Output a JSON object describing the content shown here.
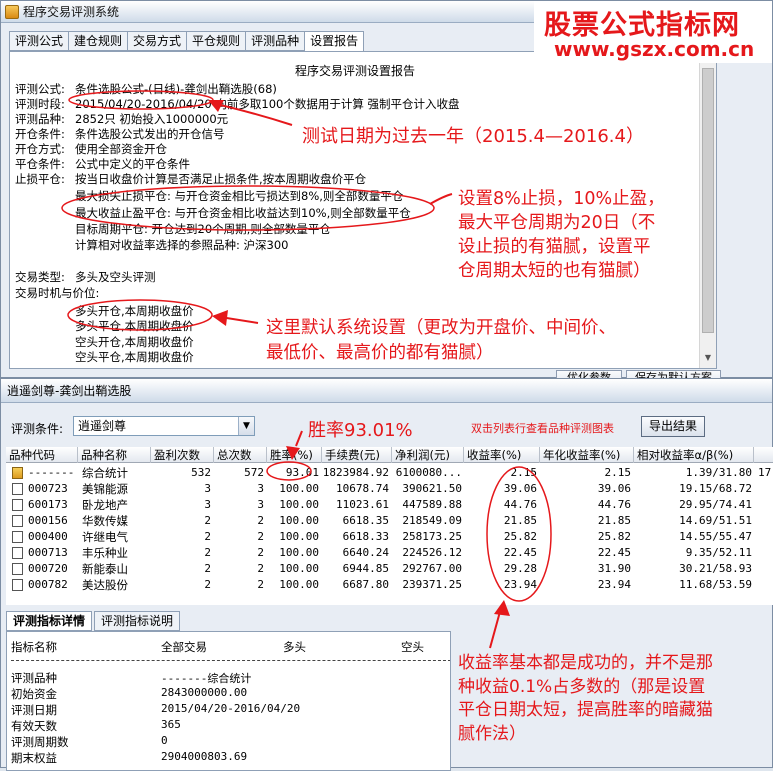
{
  "top_window": {
    "title": "程序交易评测系统",
    "tabs": [
      "评测公式",
      "建仓规则",
      "交易方式",
      "平仓规则",
      "评测品种",
      "设置报告"
    ],
    "active_tab_index": 5
  },
  "banner": {
    "line1": "股票公式指标网",
    "line2": "www.gszx.com.cn"
  },
  "report": {
    "title": "程序交易评测设置报告",
    "formula_label": "评测公式:",
    "formula_value": "条件选股公式-(日线)-龚剑出鞘选股(68)",
    "period_label": "评测时段:",
    "period_value": "2015/04/20-2016/04/20",
    "period_note": " 向前多取100个数据用于计算 强制平仓计入收盘",
    "stocks_label": "评测品种:",
    "stocks_value": "2852只 初始投入1000000元",
    "open_cond_label": "开仓条件:",
    "open_cond_value": "条件选股公式发出的开仓信号",
    "open_mode_label": "开仓方式:",
    "open_mode_value": "使用全部资金开仓",
    "close_cond_label": "平仓条件:",
    "close_cond_value": "公式中定义的平仓条件",
    "stop_label": "止损平仓:",
    "stop_value": "按当日收盘价计算是否满足止损条件,按本周期收盘价平仓",
    "max_loss": "最大损失止损平仓: 与开仓资金相比亏损达到8%,则全部数量平仓",
    "max_gain": "最大收益止盈平仓: 与开仓资金相比收益达到10%,则全部数量平仓",
    "target_period": "目标周期平仓: 开仓达到20个周期,则全部数量平仓",
    "ref_index": "计算相对收益率选择的参照品种: 沪深300",
    "trade_type_label": "交易类型:",
    "trade_type_value": "多头及空头评测",
    "timing_label": "交易时机与价位:",
    "timing": [
      "多头开仓,本周期收盘价",
      "多头平仓,本周期收盘价",
      "空头开仓,本周期收盘价",
      "空头平仓,本周期收盘价"
    ]
  },
  "buttons": {
    "optimize": "优化参数",
    "save_default": "保存为默认方案",
    "export": "导出结果"
  },
  "bottom_window": {
    "title": "逍遥剑尊-龚剑出鞘选股",
    "criteria_label": "评测条件:",
    "criteria_value": "逍遥剑尊",
    "dblclick_hint": "双击列表行查看品种评测图表"
  },
  "table": {
    "headers": [
      "品种代码",
      "品种名称",
      "盈利次数",
      "总次数",
      "胜率(%)",
      "手续费(元)",
      "净利润(元)",
      "收益率(%)",
      "年化收益率(%)",
      "相对收益率α/β(%)"
    ],
    "rows": [
      {
        "code": "-------",
        "name": "综合统计",
        "wins": "532",
        "total": "572",
        "winrate": "93.01",
        "fee": "1823984.92",
        "profit": "6100080...",
        "ret": "2.15",
        "annual": "2.15",
        "relative": "1.39/31.80",
        "extra": "17"
      },
      {
        "code": "000723",
        "name": "美锦能源",
        "wins": "3",
        "total": "3",
        "winrate": "100.00",
        "fee": "10678.74",
        "profit": "390621.50",
        "ret": "39.06",
        "annual": "39.06",
        "relative": "19.15/68.72",
        "extra": ""
      },
      {
        "code": "600173",
        "name": "卧龙地产",
        "wins": "3",
        "total": "3",
        "winrate": "100.00",
        "fee": "11023.61",
        "profit": "447589.88",
        "ret": "44.76",
        "annual": "44.76",
        "relative": "29.95/74.41",
        "extra": ""
      },
      {
        "code": "000156",
        "name": "华数传媒",
        "wins": "2",
        "total": "2",
        "winrate": "100.00",
        "fee": "6618.35",
        "profit": "218549.09",
        "ret": "21.85",
        "annual": "21.85",
        "relative": "14.69/51.51",
        "extra": ""
      },
      {
        "code": "000400",
        "name": "许继电气",
        "wins": "2",
        "total": "2",
        "winrate": "100.00",
        "fee": "6618.33",
        "profit": "258173.25",
        "ret": "25.82",
        "annual": "25.82",
        "relative": "14.55/55.47",
        "extra": ""
      },
      {
        "code": "000713",
        "name": "丰乐种业",
        "wins": "2",
        "total": "2",
        "winrate": "100.00",
        "fee": "6640.24",
        "profit": "224526.12",
        "ret": "22.45",
        "annual": "22.45",
        "relative": "9.35/52.11",
        "extra": ""
      },
      {
        "code": "000720",
        "name": "新能泰山",
        "wins": "2",
        "total": "2",
        "winrate": "100.00",
        "fee": "6944.85",
        "profit": "292767.00",
        "ret": "29.28",
        "annual": "31.90",
        "relative": "30.21/58.93",
        "extra": ""
      },
      {
        "code": "000782",
        "name": "美达股份",
        "wins": "2",
        "total": "2",
        "winrate": "100.00",
        "fee": "6687.80",
        "profit": "239371.25",
        "ret": "23.94",
        "annual": "23.94",
        "relative": "11.68/53.59",
        "extra": ""
      }
    ]
  },
  "detail": {
    "tabs": [
      "评测指标详情",
      "评测指标说明"
    ],
    "headers": [
      "指标名称",
      "全部交易",
      "多头",
      "空头"
    ],
    "rows": [
      {
        "label": "评测品种",
        "value": "-------综合统计"
      },
      {
        "label": "初始资金",
        "value": "2843000000.00"
      },
      {
        "label": "评测日期",
        "value": "2015/04/20-2016/04/20"
      },
      {
        "label": "有效天数",
        "value": "365"
      },
      {
        "label": "评测周期数",
        "value": "0"
      },
      {
        "label": "期末权益",
        "value": "2904000803.69"
      }
    ]
  },
  "annotations": {
    "a1": "测试日期为过去一年（2015.4—2016.4）",
    "a2": [
      "设置8%止损，10%止盈，",
      "最大平仓周期为20日（不",
      "设止损的有猫腻，设置平",
      "仓周期太短的也有猫腻）"
    ],
    "a3": [
      "这里默认系统设置（更改为开盘价、中间价、",
      "最低价、最高价的都有猫腻）"
    ],
    "a4": "胜率93.01%",
    "a5": [
      "收益率基本都是成功的，并不是那",
      "种收益0.1%占多数的（那是设置",
      "平仓日期太短，提高胜率的暗藏猫",
      "腻作法）"
    ],
    "color": "#e5181b"
  }
}
